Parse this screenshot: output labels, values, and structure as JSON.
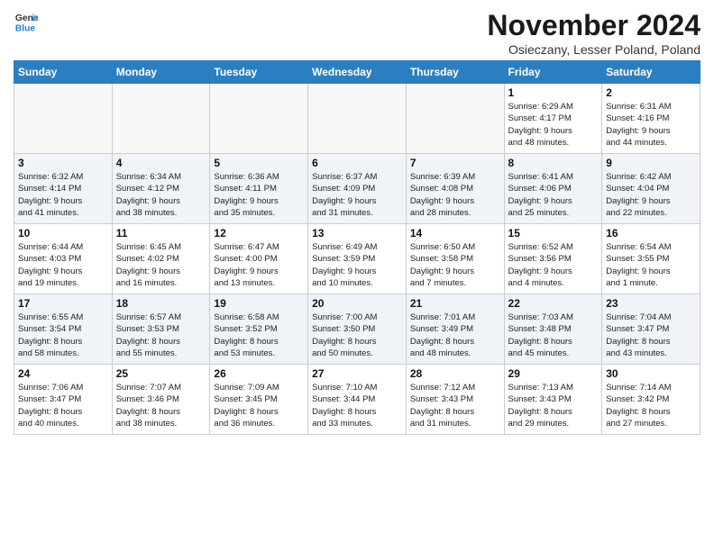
{
  "header": {
    "logo_line1": "General",
    "logo_line2": "Blue",
    "month": "November 2024",
    "location": "Osieczany, Lesser Poland, Poland"
  },
  "weekdays": [
    "Sunday",
    "Monday",
    "Tuesday",
    "Wednesday",
    "Thursday",
    "Friday",
    "Saturday"
  ],
  "weeks": [
    [
      {
        "day": "",
        "info": ""
      },
      {
        "day": "",
        "info": ""
      },
      {
        "day": "",
        "info": ""
      },
      {
        "day": "",
        "info": ""
      },
      {
        "day": "",
        "info": ""
      },
      {
        "day": "1",
        "info": "Sunrise: 6:29 AM\nSunset: 4:17 PM\nDaylight: 9 hours\nand 48 minutes."
      },
      {
        "day": "2",
        "info": "Sunrise: 6:31 AM\nSunset: 4:16 PM\nDaylight: 9 hours\nand 44 minutes."
      }
    ],
    [
      {
        "day": "3",
        "info": "Sunrise: 6:32 AM\nSunset: 4:14 PM\nDaylight: 9 hours\nand 41 minutes."
      },
      {
        "day": "4",
        "info": "Sunrise: 6:34 AM\nSunset: 4:12 PM\nDaylight: 9 hours\nand 38 minutes."
      },
      {
        "day": "5",
        "info": "Sunrise: 6:36 AM\nSunset: 4:11 PM\nDaylight: 9 hours\nand 35 minutes."
      },
      {
        "day": "6",
        "info": "Sunrise: 6:37 AM\nSunset: 4:09 PM\nDaylight: 9 hours\nand 31 minutes."
      },
      {
        "day": "7",
        "info": "Sunrise: 6:39 AM\nSunset: 4:08 PM\nDaylight: 9 hours\nand 28 minutes."
      },
      {
        "day": "8",
        "info": "Sunrise: 6:41 AM\nSunset: 4:06 PM\nDaylight: 9 hours\nand 25 minutes."
      },
      {
        "day": "9",
        "info": "Sunrise: 6:42 AM\nSunset: 4:04 PM\nDaylight: 9 hours\nand 22 minutes."
      }
    ],
    [
      {
        "day": "10",
        "info": "Sunrise: 6:44 AM\nSunset: 4:03 PM\nDaylight: 9 hours\nand 19 minutes."
      },
      {
        "day": "11",
        "info": "Sunrise: 6:45 AM\nSunset: 4:02 PM\nDaylight: 9 hours\nand 16 minutes."
      },
      {
        "day": "12",
        "info": "Sunrise: 6:47 AM\nSunset: 4:00 PM\nDaylight: 9 hours\nand 13 minutes."
      },
      {
        "day": "13",
        "info": "Sunrise: 6:49 AM\nSunset: 3:59 PM\nDaylight: 9 hours\nand 10 minutes."
      },
      {
        "day": "14",
        "info": "Sunrise: 6:50 AM\nSunset: 3:58 PM\nDaylight: 9 hours\nand 7 minutes."
      },
      {
        "day": "15",
        "info": "Sunrise: 6:52 AM\nSunset: 3:56 PM\nDaylight: 9 hours\nand 4 minutes."
      },
      {
        "day": "16",
        "info": "Sunrise: 6:54 AM\nSunset: 3:55 PM\nDaylight: 9 hours\nand 1 minute."
      }
    ],
    [
      {
        "day": "17",
        "info": "Sunrise: 6:55 AM\nSunset: 3:54 PM\nDaylight: 8 hours\nand 58 minutes."
      },
      {
        "day": "18",
        "info": "Sunrise: 6:57 AM\nSunset: 3:53 PM\nDaylight: 8 hours\nand 55 minutes."
      },
      {
        "day": "19",
        "info": "Sunrise: 6:58 AM\nSunset: 3:52 PM\nDaylight: 8 hours\nand 53 minutes."
      },
      {
        "day": "20",
        "info": "Sunrise: 7:00 AM\nSunset: 3:50 PM\nDaylight: 8 hours\nand 50 minutes."
      },
      {
        "day": "21",
        "info": "Sunrise: 7:01 AM\nSunset: 3:49 PM\nDaylight: 8 hours\nand 48 minutes."
      },
      {
        "day": "22",
        "info": "Sunrise: 7:03 AM\nSunset: 3:48 PM\nDaylight: 8 hours\nand 45 minutes."
      },
      {
        "day": "23",
        "info": "Sunrise: 7:04 AM\nSunset: 3:47 PM\nDaylight: 8 hours\nand 43 minutes."
      }
    ],
    [
      {
        "day": "24",
        "info": "Sunrise: 7:06 AM\nSunset: 3:47 PM\nDaylight: 8 hours\nand 40 minutes."
      },
      {
        "day": "25",
        "info": "Sunrise: 7:07 AM\nSunset: 3:46 PM\nDaylight: 8 hours\nand 38 minutes."
      },
      {
        "day": "26",
        "info": "Sunrise: 7:09 AM\nSunset: 3:45 PM\nDaylight: 8 hours\nand 36 minutes."
      },
      {
        "day": "27",
        "info": "Sunrise: 7:10 AM\nSunset: 3:44 PM\nDaylight: 8 hours\nand 33 minutes."
      },
      {
        "day": "28",
        "info": "Sunrise: 7:12 AM\nSunset: 3:43 PM\nDaylight: 8 hours\nand 31 minutes."
      },
      {
        "day": "29",
        "info": "Sunrise: 7:13 AM\nSunset: 3:43 PM\nDaylight: 8 hours\nand 29 minutes."
      },
      {
        "day": "30",
        "info": "Sunrise: 7:14 AM\nSunset: 3:42 PM\nDaylight: 8 hours\nand 27 minutes."
      }
    ]
  ]
}
